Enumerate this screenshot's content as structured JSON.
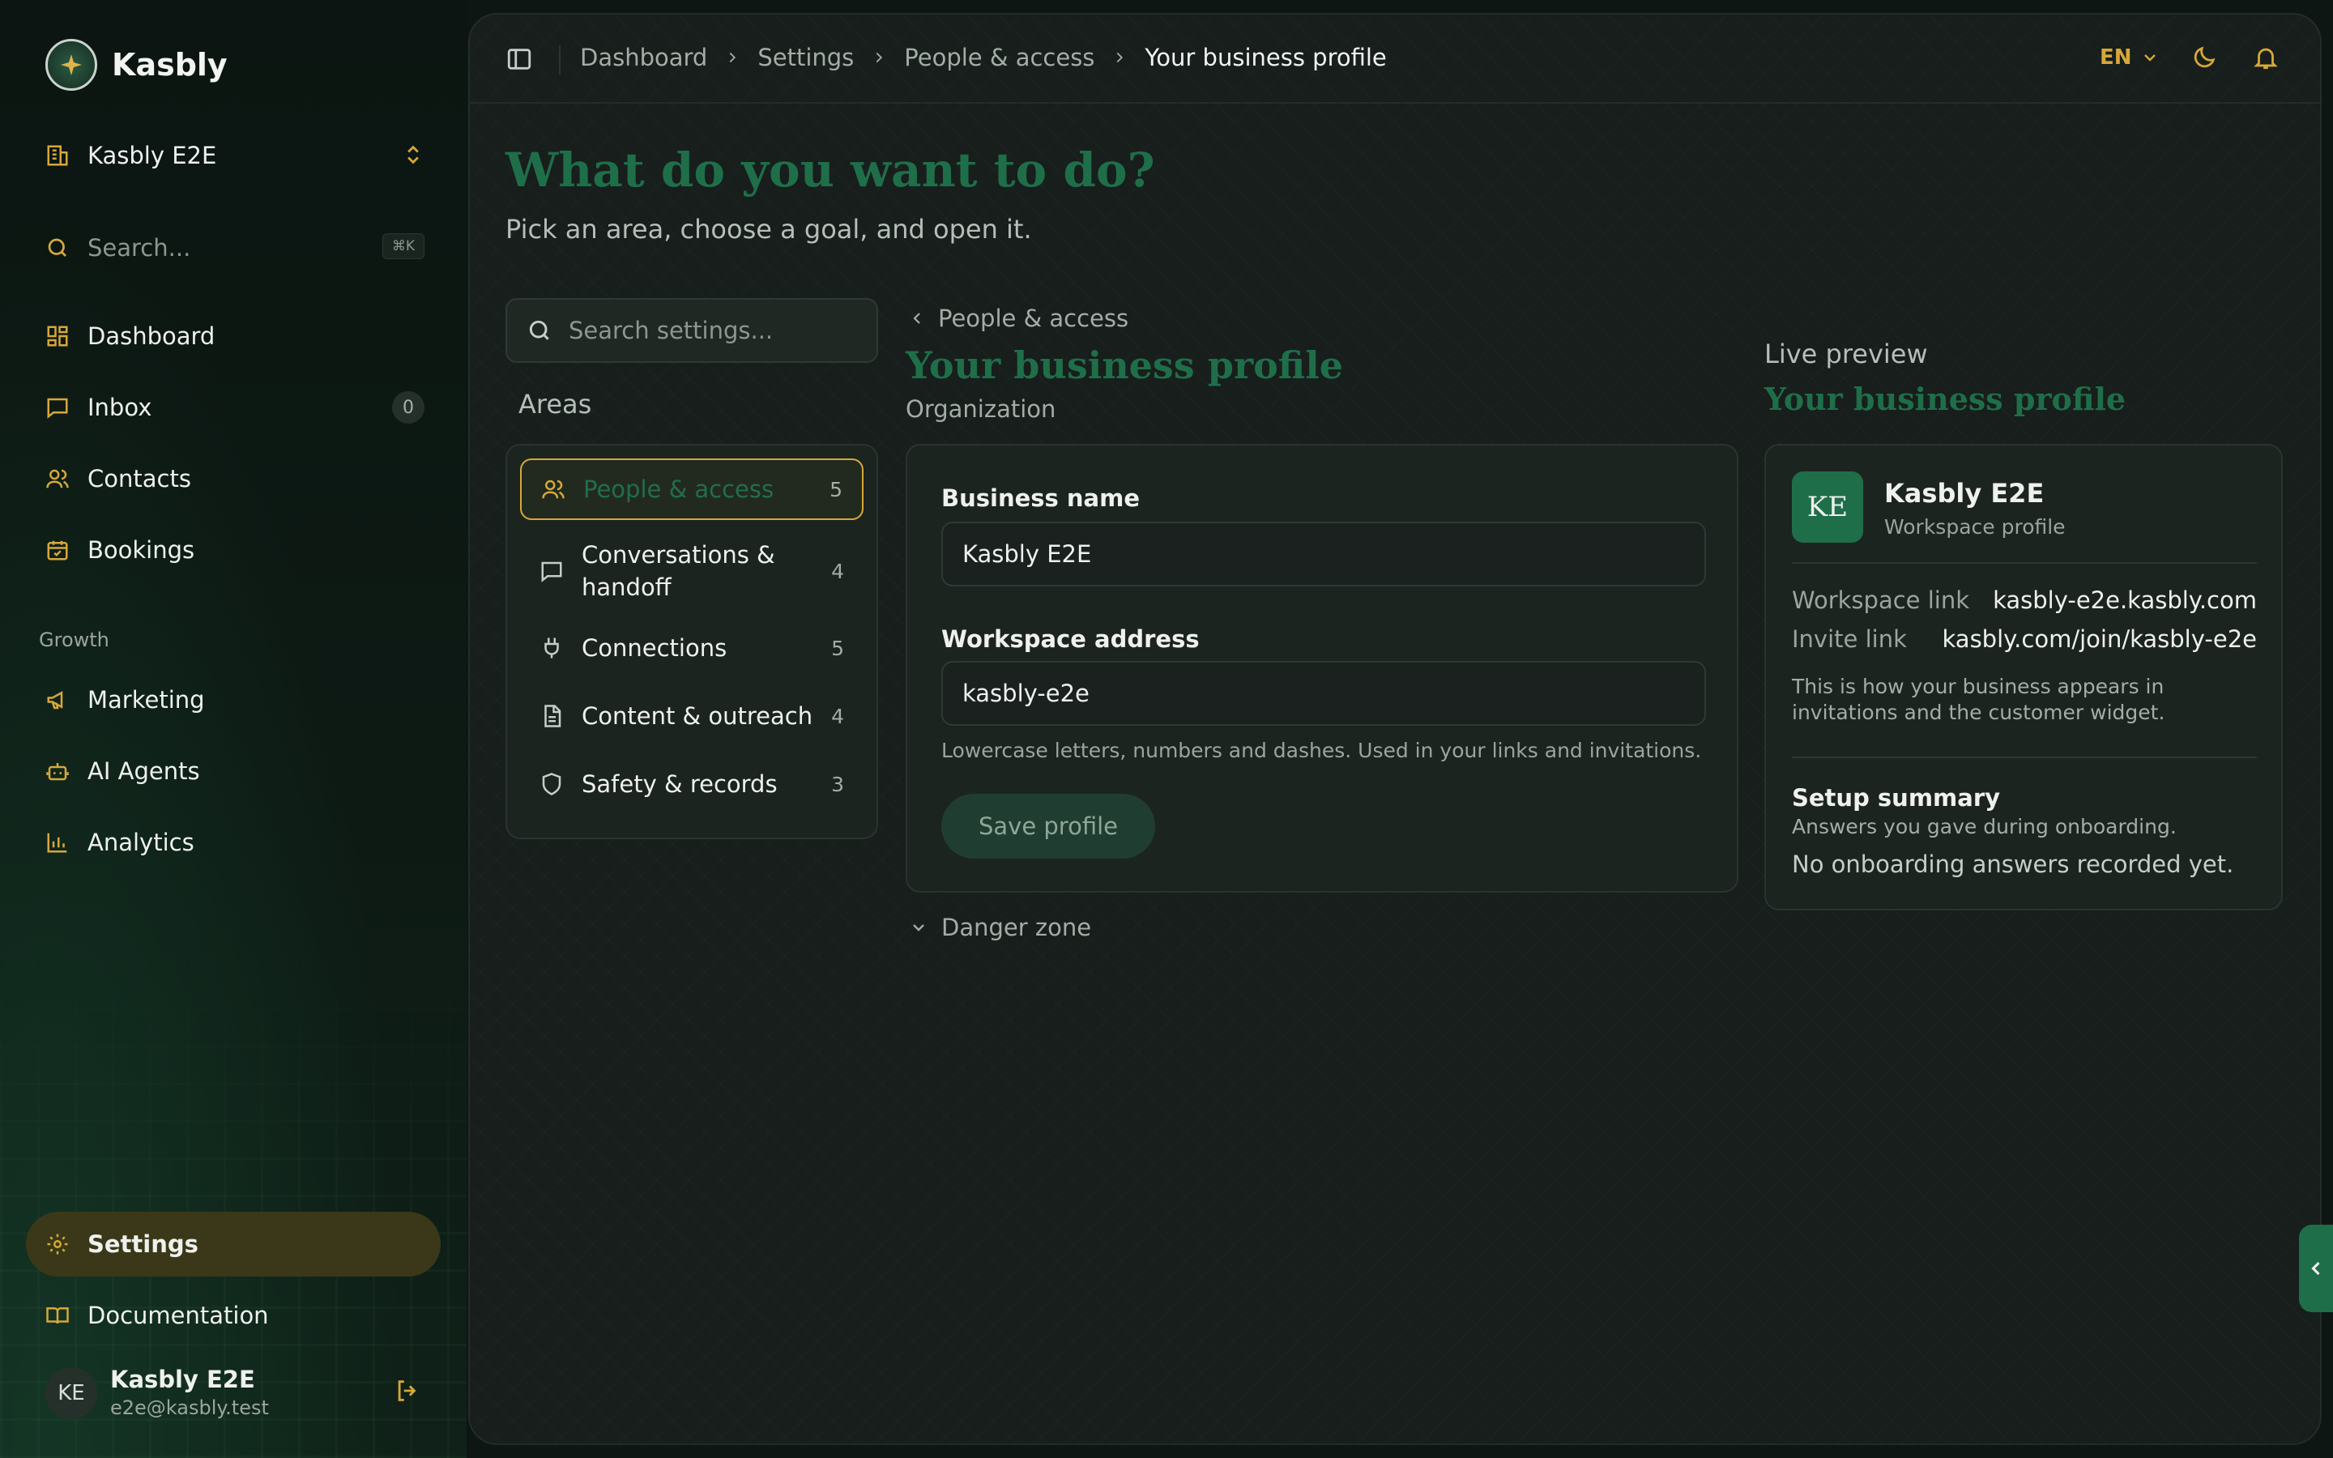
{
  "brand": {
    "name": "Kasbly"
  },
  "workspace": {
    "name": "Kasbly E2E"
  },
  "sidebar_search": {
    "placeholder": "Search...",
    "shortcut": "⌘K"
  },
  "nav": {
    "dashboard": "Dashboard",
    "inbox": "Inbox",
    "inbox_count": "0",
    "contacts": "Contacts",
    "bookings": "Bookings",
    "growth_label": "Growth",
    "marketing": "Marketing",
    "ai_agents": "AI Agents",
    "analytics": "Analytics",
    "settings": "Settings",
    "documentation": "Documentation"
  },
  "user": {
    "initials": "KE",
    "name": "Kasbly E2E",
    "email": "e2e@kasbly.test"
  },
  "breadcrumb": [
    "Dashboard",
    "Settings",
    "People & access",
    "Your business profile"
  ],
  "topbar": {
    "language": "EN"
  },
  "page": {
    "title": "What do you want to do?",
    "subtitle": "Pick an area, choose a goal, and open it."
  },
  "settings_search": {
    "placeholder": "Search settings..."
  },
  "areas": {
    "label": "Areas",
    "items": [
      {
        "label": "People & access",
        "count": "5",
        "icon": "users-icon",
        "active": true
      },
      {
        "label": "Conversations & handoff",
        "count": "4",
        "icon": "chat-icon",
        "active": false
      },
      {
        "label": "Connections",
        "count": "5",
        "icon": "plug-icon",
        "active": false
      },
      {
        "label": "Content & outreach",
        "count": "4",
        "icon": "document-icon",
        "active": false
      },
      {
        "label": "Safety & records",
        "count": "3",
        "icon": "shield-icon",
        "active": false
      }
    ]
  },
  "form": {
    "back_label": "People & access",
    "title": "Your business profile",
    "section": "Organization",
    "business_name_label": "Business name",
    "business_name_value": "Kasbly E2E",
    "workspace_address_label": "Workspace address",
    "workspace_address_value": "kasbly-e2e",
    "hint": "Lowercase letters, numbers and dashes. Used in your links and invitations.",
    "save_label": "Save profile",
    "danger_label": "Danger zone"
  },
  "preview": {
    "label": "Live preview",
    "title": "Your business profile",
    "initials": "KE",
    "name": "Kasbly E2E",
    "type": "Workspace profile",
    "workspace_link_label": "Workspace link",
    "workspace_link_value": "kasbly-e2e.kasbly.com",
    "invite_link_label": "Invite link",
    "invite_link_value": "kasbly.com/join/kasbly-e2e",
    "note": "This is how your business appears in invitations and the customer widget.",
    "setup_title": "Setup summary",
    "setup_subtitle": "Answers you gave during onboarding.",
    "setup_empty": "No onboarding answers recorded yet."
  },
  "colors": {
    "accent_gold": "#d6a83a",
    "brand_green": "#1f6e4a",
    "background": "#0d1612",
    "panel": "#171e1b"
  }
}
